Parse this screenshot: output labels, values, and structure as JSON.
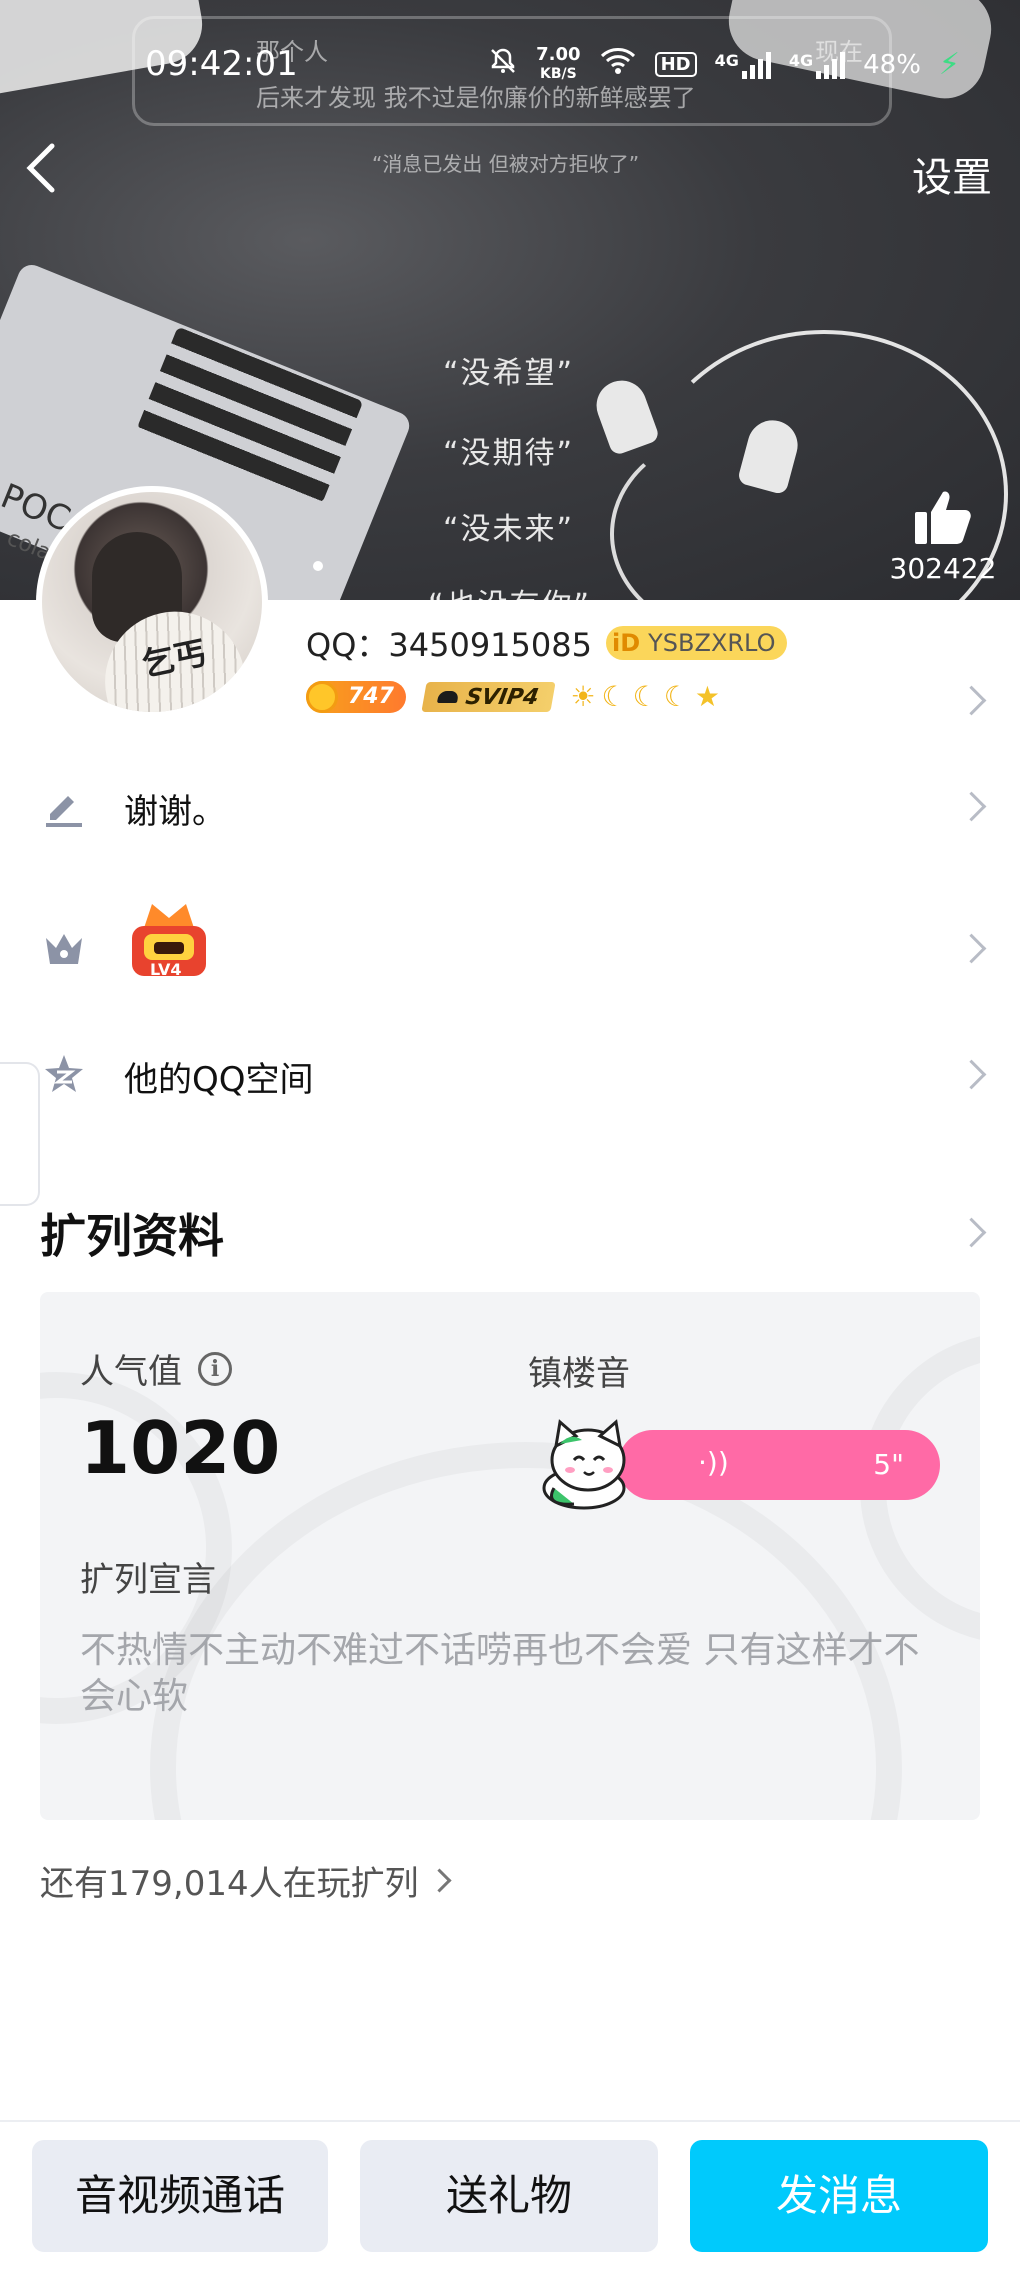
{
  "status_bar": {
    "time": "09:42:01",
    "net_speed_value": "7.00",
    "net_speed_unit": "KB/S",
    "hd": "HD",
    "signal1": "4G",
    "signal2": "4G",
    "battery": "48%"
  },
  "cover": {
    "text_top_1": "那个人",
    "text_top_2": "现在",
    "text_top_3": "后来才发现  我不过是你廉价的新鲜感罢了",
    "text_notice": "“消息已发出  但被对方拒收了”",
    "quotes": [
      "“没希望”",
      "“没期待”",
      "“没未来”",
      "“也没有你”"
    ],
    "box_text": "POC",
    "box_text2": "colat"
  },
  "nav": {
    "settings_label": "设置"
  },
  "likes": {
    "count": "302422"
  },
  "profile": {
    "qq_label": "QQ：3450915085",
    "id_badge_prefix": "iD",
    "id_badge_value": "YSBZXRLO",
    "coin_value": "747",
    "svip_label": "SVIP4",
    "avatar_fan_text": "乞丐"
  },
  "rows": {
    "signature": "谢谢。",
    "medal_label": "LV4",
    "qzone": "他的QQ空间"
  },
  "kuolie": {
    "section_title": "扩列资料",
    "popularity_label": "人气值",
    "popularity_value": "1020",
    "voice_label": "镇楼音",
    "voice_duration": "5\"",
    "declaration_label": "扩列宣言",
    "declaration_text": "不热情不主动不难过不话唠再也不会爱 只有这样才不会心软",
    "more_players": "还有179,014人在玩扩列"
  },
  "bottom_bar": {
    "call_label": "音视频通话",
    "gift_label": "送礼物",
    "message_label": "发消息"
  },
  "colors": {
    "accent_blue": "#00cafc",
    "voice_pink": "#ff6aa6",
    "badge_gold": "#fbd65a"
  }
}
